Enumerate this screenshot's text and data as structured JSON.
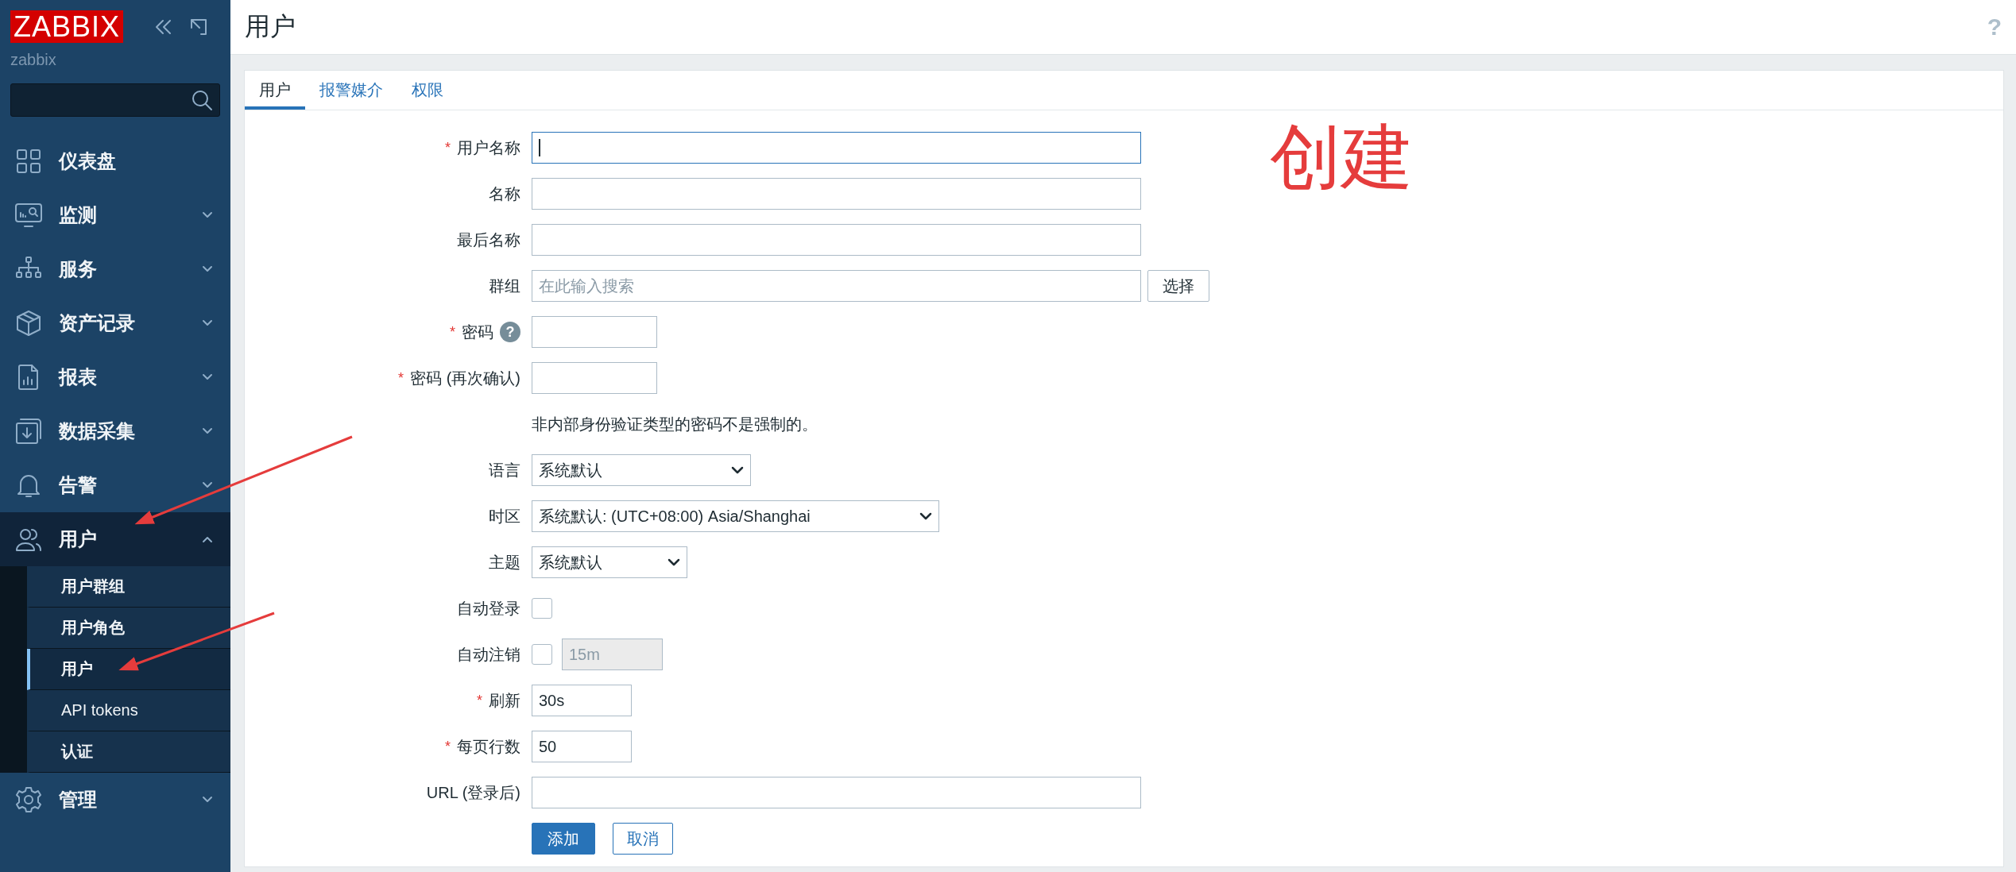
{
  "sidebar": {
    "logo": "ZABBIX",
    "server": "zabbix",
    "menu": [
      {
        "label": "仪表盘",
        "kind": "link"
      },
      {
        "label": "监测",
        "kind": "group",
        "expanded": false
      },
      {
        "label": "服务",
        "kind": "group",
        "expanded": false
      },
      {
        "label": "资产记录",
        "kind": "group",
        "expanded": false
      },
      {
        "label": "报表",
        "kind": "group",
        "expanded": false
      },
      {
        "label": "数据采集",
        "kind": "group",
        "expanded": false
      },
      {
        "label": "告警",
        "kind": "group",
        "expanded": false
      },
      {
        "label": "用户",
        "kind": "group",
        "expanded": true,
        "children": [
          {
            "label": "用户群组",
            "selected": false
          },
          {
            "label": "用户角色",
            "selected": false
          },
          {
            "label": "用户",
            "selected": true
          },
          {
            "label": "API tokens",
            "selected": false
          },
          {
            "label": "认证",
            "selected": false
          }
        ]
      },
      {
        "label": "管理",
        "kind": "group",
        "expanded": false
      }
    ]
  },
  "page": {
    "title": "用户",
    "help": "?"
  },
  "tabs": [
    {
      "label": "用户",
      "selected": true
    },
    {
      "label": "报警媒介",
      "selected": false
    },
    {
      "label": "权限",
      "selected": false
    }
  ],
  "form": {
    "required_mark": "*",
    "rows": [
      {
        "kind": "text",
        "label": "用户名称",
        "required": true,
        "focused": true
      },
      {
        "kind": "text",
        "label": "名称",
        "required": false,
        "focused": false
      },
      {
        "kind": "text",
        "label": "最后名称",
        "required": false,
        "focused": false
      },
      {
        "kind": "multiselect",
        "label": "群组",
        "required": false,
        "placeholder": "在此输入搜索",
        "button": "选择"
      },
      {
        "kind": "password",
        "label": "密码",
        "required": true,
        "help": "?"
      },
      {
        "kind": "password",
        "label": "密码 (再次确认)",
        "required": true
      },
      {
        "kind": "note",
        "text": "非内部身份验证类型的密码不是强制的。"
      },
      {
        "kind": "select",
        "label": "语言",
        "required": false,
        "value": "系统默认"
      },
      {
        "kind": "select",
        "label": "时区",
        "required": false,
        "value": "系统默认: (UTC+08:00) Asia/Shanghai"
      },
      {
        "kind": "select",
        "label": "主题",
        "required": false,
        "value": "系统默认"
      },
      {
        "kind": "checkbox",
        "label": "自动登录",
        "required": false,
        "checked": false
      },
      {
        "kind": "checkbox_field",
        "label": "自动注销",
        "required": false,
        "checked": false,
        "value": "15m",
        "disabled": true
      },
      {
        "kind": "short",
        "label": "刷新",
        "required": true,
        "value": "30s"
      },
      {
        "kind": "short",
        "label": "每页行数",
        "required": true,
        "value": "50"
      },
      {
        "kind": "text",
        "label": "URL (登录后)",
        "required": false,
        "focused": false
      }
    ],
    "buttons": [
      {
        "label": "添加",
        "primary": true
      },
      {
        "label": "取消",
        "primary": false
      }
    ]
  },
  "annotation": {
    "text": "创建"
  }
}
